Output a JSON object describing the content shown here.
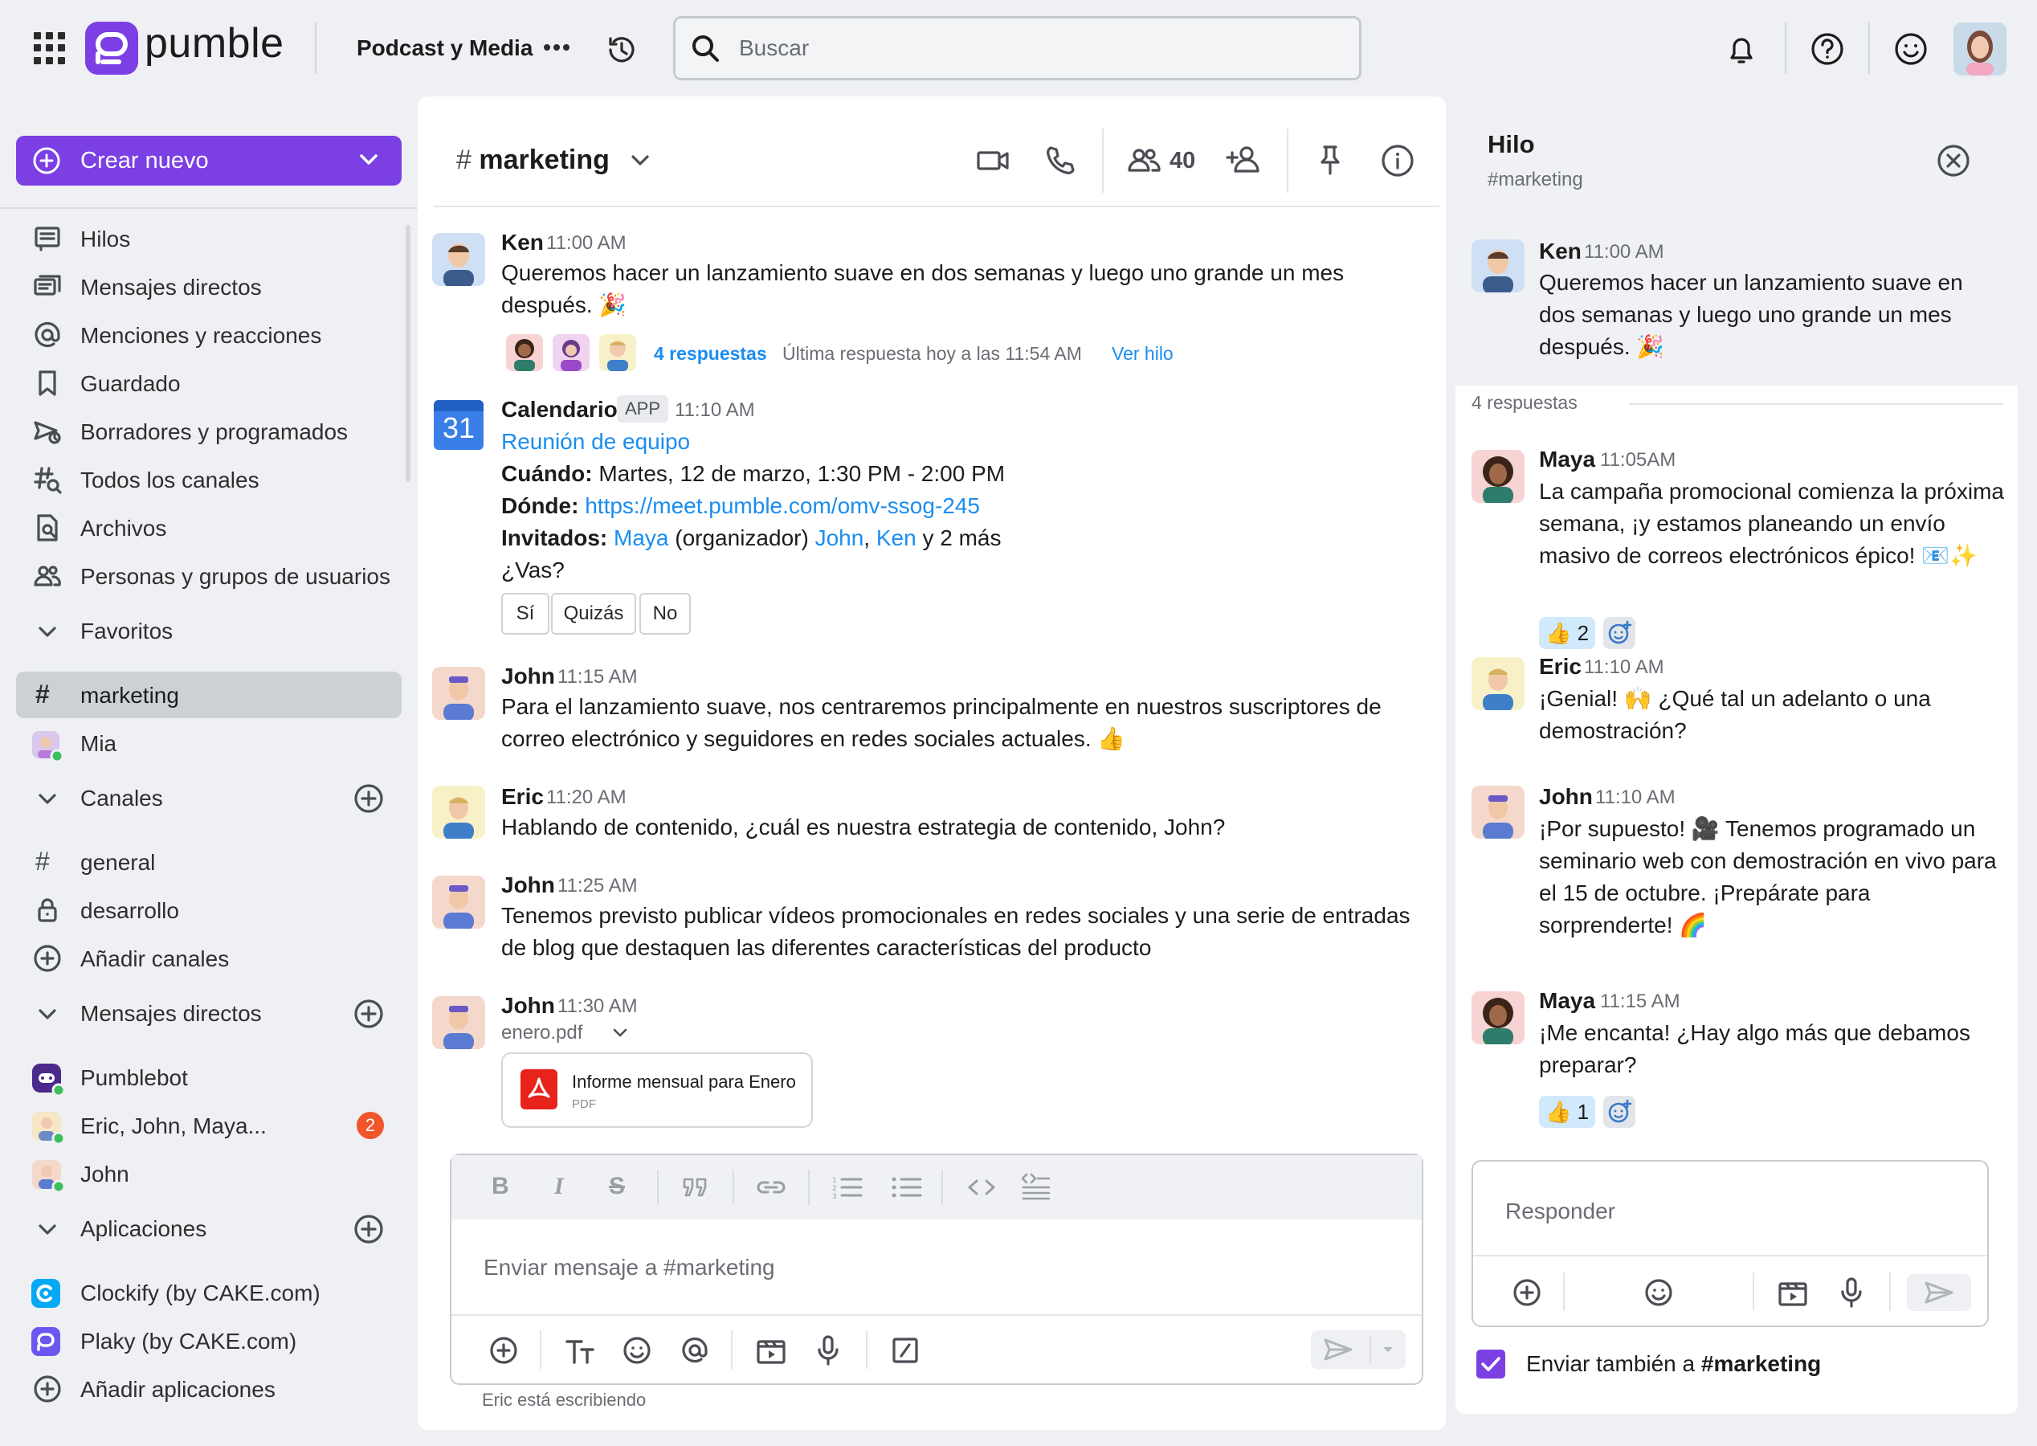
{
  "app": {
    "logo_text": "pumble",
    "workspace_name": "Podcast y Media",
    "search_placeholder": "Buscar"
  },
  "sidebar": {
    "create_label": "Crear nuevo",
    "nav": [
      {
        "label": "Hilos",
        "icon": "threads-icon"
      },
      {
        "label": "Mensajes directos",
        "icon": "direct-messages-icon"
      },
      {
        "label": "Menciones y reacciones",
        "icon": "at-icon"
      },
      {
        "label": "Guardado",
        "icon": "bookmark-icon"
      },
      {
        "label": "Borradores y programados",
        "icon": "drafts-icon"
      },
      {
        "label": "Todos los canales",
        "icon": "channel-search-icon"
      },
      {
        "label": "Archivos",
        "icon": "files-icon"
      },
      {
        "label": "Personas y grupos de usuarios",
        "icon": "people-icon"
      }
    ],
    "favorites_label": "Favoritos",
    "favorites": [
      {
        "label": "marketing",
        "icon": "hash-icon"
      },
      {
        "label": "Mia",
        "icon": "avatar"
      }
    ],
    "channels_label": "Canales",
    "channels": [
      {
        "label": "general"
      },
      {
        "label": "desarrollo"
      },
      {
        "label": "Añadir canales"
      }
    ],
    "dms_label": "Mensajes directos",
    "dms": [
      {
        "label": "Pumblebot"
      },
      {
        "label": "Eric, John, Maya...",
        "badge": "2"
      },
      {
        "label": "John"
      }
    ],
    "apps_label": "Aplicaciones",
    "apps": [
      {
        "label": "Clockify (by CAKE.com)"
      },
      {
        "label": "Plaky (by CAKE.com)"
      },
      {
        "label": "Añadir aplicaciones"
      }
    ]
  },
  "channel": {
    "name": "marketing",
    "member_count": "40"
  },
  "messages": {
    "ken": {
      "name": "Ken",
      "time": "11:00 AM",
      "text": "Queremos hacer un lanzamiento suave en dos semanas y luego uno grande un mes después. 🎉",
      "replies_label": "4 respuestas",
      "last_reply": "Última respuesta hoy a las 11:54 AM",
      "view_thread": "Ver hilo"
    },
    "calendar": {
      "name": "Calendario",
      "tag": "APP",
      "time": "11:10 AM",
      "icon_day": "31",
      "event_title": "Reunión de equipo",
      "when_label": "Cuándo:",
      "when_value": "Martes, 12 de marzo, 1:30 PM - 2:00 PM",
      "where_label": "Dónde:",
      "where_value": "https://meet.pumble.com/omv-ssog-245",
      "invited_label": "Invitados:",
      "invited_maya": "Maya",
      "invited_org": "(organizador)",
      "invited_john": "John",
      "invited_sep": ",",
      "invited_ken": "Ken",
      "invited_more": "y 2 más",
      "question": "¿Vas?",
      "rsvp_yes": "Sí",
      "rsvp_maybe": "Quizás",
      "rsvp_no": "No"
    },
    "john1": {
      "name": "John",
      "time": "11:15 AM",
      "text": "Para el lanzamiento suave, nos centraremos principalmente en nuestros suscriptores de correo electrónico y seguidores en redes sociales actuales. 👍"
    },
    "eric": {
      "name": "Eric",
      "time": "11:20 AM",
      "text": "Hablando de contenido, ¿cuál es nuestra estrategia de contenido, John?"
    },
    "john2": {
      "name": "John",
      "time": "11:25 AM",
      "text": "Tenemos previsto publicar vídeos promocionales en redes sociales y una serie de entradas de blog que destaquen las diferentes características del producto"
    },
    "john3": {
      "name": "John",
      "time": "11:30 AM",
      "file_name": "enero.pdf",
      "file_title": "Informe mensual para Enero",
      "file_type": "PDF"
    }
  },
  "composer": {
    "placeholder": "Enviar mensaje a #marketing",
    "typing": "Eric está escribiendo"
  },
  "thread": {
    "title": "Hilo",
    "channel": "#marketing",
    "parent": {
      "name": "Ken",
      "time": "11:00 AM",
      "text": "Queremos hacer un lanzamiento suave en dos semanas y luego uno grande un mes después. 🎉"
    },
    "replies_label": "4 respuestas",
    "replies": [
      {
        "name": "Maya",
        "time": "11:05AM",
        "text": "La campaña promocional comienza la próxima semana, ¡y estamos planeando un envío masivo de correos electrónicos épico! 📧✨",
        "reaction": "👍 2"
      },
      {
        "name": "Eric",
        "time": "11:10 AM",
        "text": "¡Genial! 🙌 ¿Qué tal un adelanto o una demostración?"
      },
      {
        "name": "John",
        "time": "11:10 AM",
        "text": "¡Por supuesto! 🎥 Tenemos programado un seminario web con demostración en vivo para el 15 de octubre. ¡Prepárate para sorprenderte! 🌈"
      },
      {
        "name": "Maya",
        "time": "11:15 AM",
        "text": "¡Me encanta! ¿Hay algo más que debamos preparar?",
        "reaction": "👍 1"
      }
    ],
    "reply_placeholder": "Responder",
    "also_send_prefix": "Enviar también a ",
    "also_send_channel": "#marketing"
  }
}
